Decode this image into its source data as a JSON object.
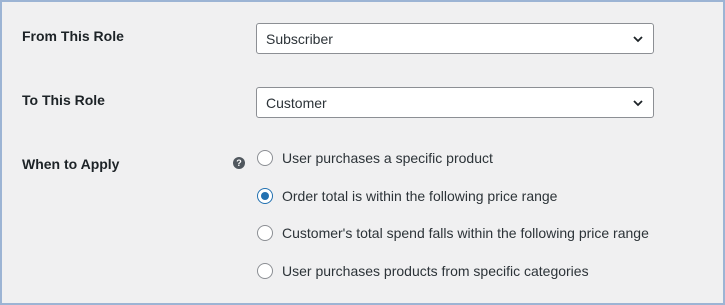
{
  "form": {
    "from_role": {
      "label": "From This Role",
      "value": "Subscriber"
    },
    "to_role": {
      "label": "To This Role",
      "value": "Customer"
    },
    "when_to_apply": {
      "label": "When to Apply",
      "help_icon": "question-circle-icon",
      "options": [
        {
          "label": "User purchases a specific product",
          "checked": false
        },
        {
          "label": "Order total is within the following price range",
          "checked": true
        },
        {
          "label": "Customer's total spend falls within the following price range",
          "checked": false
        },
        {
          "label": "User purchases products from specific categories",
          "checked": false
        }
      ]
    }
  },
  "colors": {
    "accent": "#2271b1",
    "background": "#f0f0f1",
    "border": "#9cb4d4"
  }
}
